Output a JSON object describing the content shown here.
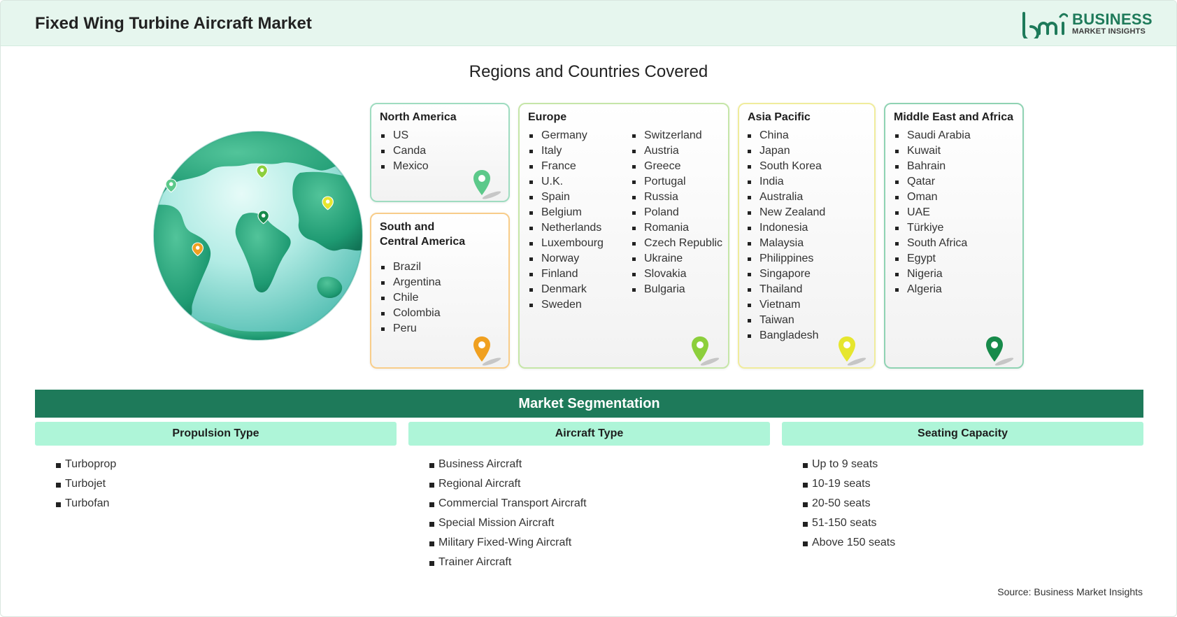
{
  "header": {
    "title": "Fixed Wing Turbine Aircraft Market",
    "logo_word": "BUSINESS",
    "logo_sub": "MARKET INSIGHTS",
    "brand_color": "#1e7a5a"
  },
  "regions": {
    "title": "Regions and Countries Covered",
    "north_america": {
      "name": "North America",
      "pin_color": "#5cc98a",
      "items": [
        "US",
        "Canda",
        "Mexico"
      ]
    },
    "south_central_america": {
      "name_line1": "South and",
      "name_line2": "Central America",
      "pin_color": "#f0a020",
      "items": [
        "Brazil",
        "Argentina",
        "Chile",
        "Colombia",
        "Peru"
      ]
    },
    "europe": {
      "name": "Europe",
      "pin_color": "#8ccf3c",
      "items_col1": [
        "Germany",
        "Italy",
        "France",
        "U.K.",
        "Spain",
        "Belgium",
        "Netherlands",
        "Luxembourg",
        "Norway",
        "Finland",
        "Denmark",
        "Sweden"
      ],
      "items_col2": [
        "Switzerland",
        "Austria",
        "Greece",
        "Portugal",
        "Russia",
        "Poland",
        "Romania",
        "Czech Republic",
        "Ukraine",
        "Slovakia",
        "Bulgaria"
      ]
    },
    "asia_pacific": {
      "name": "Asia Pacific",
      "pin_color": "#e6e62e",
      "items": [
        "China",
        "Japan",
        "South Korea",
        "India",
        "Australia",
        "New Zealand",
        "Indonesia",
        "Malaysia",
        "Philippines",
        "Singapore",
        "Thailand",
        "Vietnam",
        "Taiwan",
        "Bangladesh"
      ]
    },
    "middle_east_africa": {
      "name": "Middle East and Africa",
      "pin_color": "#178a4a",
      "items": [
        "Saudi Arabia",
        "Kuwait",
        "Bahrain",
        "Qatar",
        "Oman",
        "UAE",
        "Türkiye",
        "South Africa",
        "Egypt",
        "Nigeria",
        "Algeria"
      ]
    }
  },
  "segmentation": {
    "title": "Market Segmentation",
    "columns": [
      {
        "heading": "Propulsion Type",
        "items": [
          "Turboprop",
          "Turbojet",
          "Turbofan"
        ]
      },
      {
        "heading": "Aircraft Type",
        "items": [
          "Business Aircraft",
          "Regional Aircraft",
          "Commercial Transport Aircraft",
          "Special Mission Aircraft",
          "Military Fixed-Wing Aircraft",
          "Trainer Aircraft"
        ]
      },
      {
        "heading": "Seating Capacity",
        "items": [
          "Up to 9 seats",
          "10-19 seats",
          "20-50 seats",
          "51-150 seats",
          "Above 150 seats"
        ]
      }
    ]
  },
  "source": "Source: Business Market Insights"
}
